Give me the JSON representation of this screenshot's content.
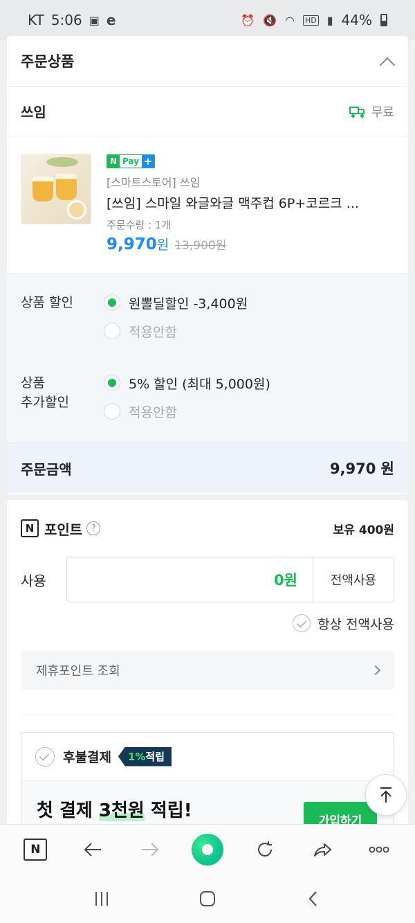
{
  "status_bar": {
    "carrier": "KT",
    "time": "5:06",
    "left_icons": [
      "gallery-icon",
      "e-icon"
    ],
    "right_icons": [
      "alarm-icon",
      "mute-icon",
      "wifi-icon",
      "hd-icon",
      "signal-icon"
    ],
    "battery": "44%"
  },
  "order_products": {
    "title": "주문상품",
    "seller": "쓰임",
    "shipping": "무료",
    "product": {
      "badge_n": "N",
      "badge_pay": "Pay",
      "badge_plus": "+",
      "store": "[스마트스토어] 쓰임",
      "name": "[쓰임] 스마일 와글와글 맥주컵 6P+코르크 ...",
      "quantity": "주문수량 : 1개",
      "price": "9,970",
      "price_unit": "원",
      "original_price": "13,900원"
    },
    "discount": {
      "label": "상품 할인",
      "options": [
        {
          "label": "원뽈딜할인 -3,400원",
          "selected": true
        },
        {
          "label": "적용안함",
          "selected": false
        }
      ]
    },
    "extra_discount": {
      "label_line1": "상품",
      "label_line2": "추가할인",
      "options": [
        {
          "label": "5% 할인 (최대 5,000원)",
          "selected": true
        },
        {
          "label": "적용안함",
          "selected": false
        }
      ]
    },
    "order_total": {
      "label": "주문금액",
      "amount": "9,970 원"
    }
  },
  "points": {
    "logo": "N",
    "title": "포인트",
    "help": "?",
    "owned": "보유 400원",
    "use_label": "사용",
    "use_value": "0원",
    "use_all_button": "전액사용",
    "always_use_all": "항상 전액사용",
    "affiliate_link": "제휴포인트 조회"
  },
  "deferred_payment": {
    "title": "후불결제",
    "rebate_pct": "1%",
    "rebate_text": " 적립",
    "promo_prefix": "첫 결제 ",
    "promo_highlight": "3천원",
    "promo_suffix": " 적립!",
    "join_button": "가입하기"
  },
  "toolbar": {
    "n_button": "N"
  },
  "colors": {
    "naver_green": "#1aba56",
    "price_blue": "#1d8cf8",
    "rebate_navy": "#153855"
  }
}
